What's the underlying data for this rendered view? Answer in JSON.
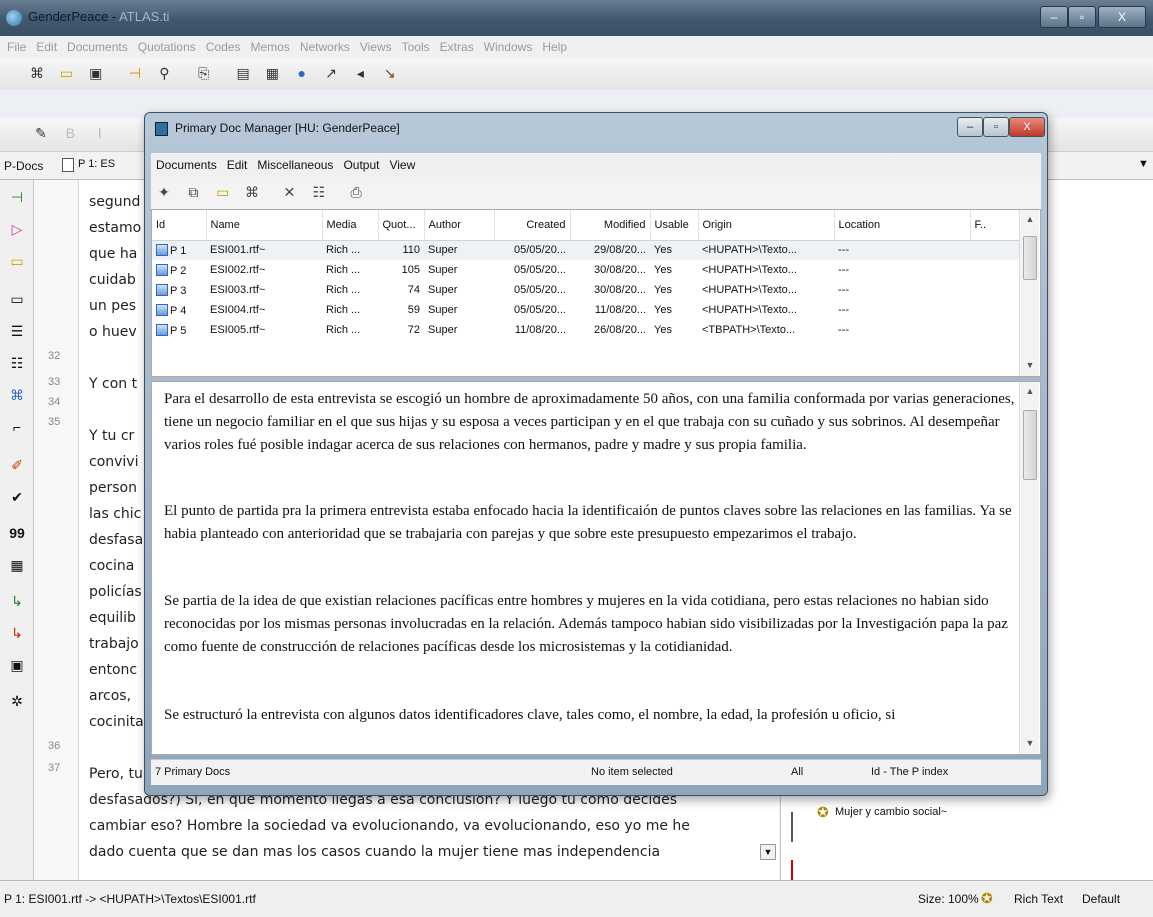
{
  "window": {
    "title_main": "GenderPeace - ",
    "title_app": "ATLAS.ti",
    "btn_min": "–",
    "btn_max": "▫",
    "btn_close": "X"
  },
  "menu": [
    "File",
    "Edit",
    "Documents",
    "Quotations",
    "Codes",
    "Memos",
    "Networks",
    "Views",
    "Tools",
    "Extras",
    "Windows",
    "Help"
  ],
  "pdocs": {
    "label": "P-Docs",
    "doc": "P 1: ES"
  },
  "editor": {
    "lines": [
      "segund",
      "estamo",
      "que ha",
      "cuidab",
      "un pes",
      "o huev",
      "Y con t",
      "Y tu cr",
      "convivi",
      "person",
      "las chic",
      "desfasa",
      "cocina",
      "policías",
      "equilib",
      "trabajo",
      "entonc",
      "arcos,",
      "cocinita",
      "Pero, tu",
      "desfasados?) Si, en que momento llegas a esa conclusion? Y luego tu como decides",
      "cambiar eso? Hombre la sociedad va evolucionando, va evolucionando, eso yo me he",
      "dado cuenta que se dan mas los casos cuando la mujer tiene mas independencia"
    ],
    "line_numbers": [
      "32",
      "33",
      "34",
      "35",
      "36",
      "37"
    ]
  },
  "right_pane": {
    "code_label": "Mujer y cambio social~"
  },
  "status": {
    "path": "P 1: ESI001.rtf -> <HUPATH>\\Textos\\ESI001.rtf",
    "size": "Size: 100%",
    "format": "Rich Text",
    "style": "Default"
  },
  "dialog": {
    "title": "Primary Doc Manager [HU: GenderPeace]",
    "btn_min": "–",
    "btn_max": "▫",
    "btn_close": "X",
    "menu": [
      "Documents",
      "Edit",
      "Miscellaneous",
      "Output",
      "View"
    ],
    "columns": [
      "Id",
      "Name",
      "Media",
      "Quot...",
      "Author",
      "Created",
      "Modified",
      "Usable",
      "Origin",
      "Location",
      "F.."
    ],
    "rows": [
      [
        "P 1",
        "ESI001.rtf~",
        "Rich ...",
        "110",
        "Super",
        "05/05/20...",
        "29/08/20...",
        "Yes",
        "<HUPATH>\\Texto...",
        "---"
      ],
      [
        "P 2",
        "ESI002.rtf~",
        "Rich ...",
        "105",
        "Super",
        "05/05/20...",
        "30/08/20...",
        "Yes",
        "<HUPATH>\\Texto...",
        "---"
      ],
      [
        "P 3",
        "ESI003.rtf~",
        "Rich ...",
        "74",
        "Super",
        "05/05/20...",
        "30/08/20...",
        "Yes",
        "<HUPATH>\\Texto...",
        "---"
      ],
      [
        "P 4",
        "ESI004.rtf~",
        "Rich ...",
        "59",
        "Super",
        "05/05/20...",
        "11/08/20...",
        "Yes",
        "<HUPATH>\\Texto...",
        "---"
      ],
      [
        "P 5",
        "ESI005.rtf~",
        "Rich ...",
        "72",
        "Super",
        "11/08/20...",
        "26/08/20...",
        "Yes",
        "<TBPATH>\\Texto...",
        "---"
      ]
    ],
    "paragraphs": [
      "Para el desarrollo de esta entrevista se escogió un hombre de aproximadamente 50 años, con una familia conformada por varias generaciones, tiene un negocio familiar en el que sus hijas y su esposa a veces participan y en el que trabaja con su cuñado y sus sobrinos. Al desempeñar varios roles fué posible indagar acerca de sus relaciones con hermanos, padre y madre y sus propia familia.",
      "El punto de partida pra la primera entrevista estaba enfocado hacia la identificaión de puntos claves sobre las relaciones en las familias. Ya se habia planteado con anterioridad que se trabajaria con parejas y que sobre este presupuesto empezarimos el trabajo.",
      "Se partia de la idea de que existian relaciones pacíficas entre hombres y mujeres en la vida cotidiana, pero estas relaciones no habian sido reconocidas por los mismas personas involucradas en la relación. Además tampoco habian sido visibilizadas por la Investigación papa la paz como fuente de construcción de relaciones pacíficas desde los microsistemas y la cotidianidad.",
      "Se estructuró la entrevista con algunos datos identificadores clave, tales como, el nombre, la edad, la profesión u oficio, si"
    ],
    "status": {
      "count": "7 Primary Docs",
      "selection": "No item selected",
      "filter": "All",
      "sort": "Id - The P index"
    }
  }
}
